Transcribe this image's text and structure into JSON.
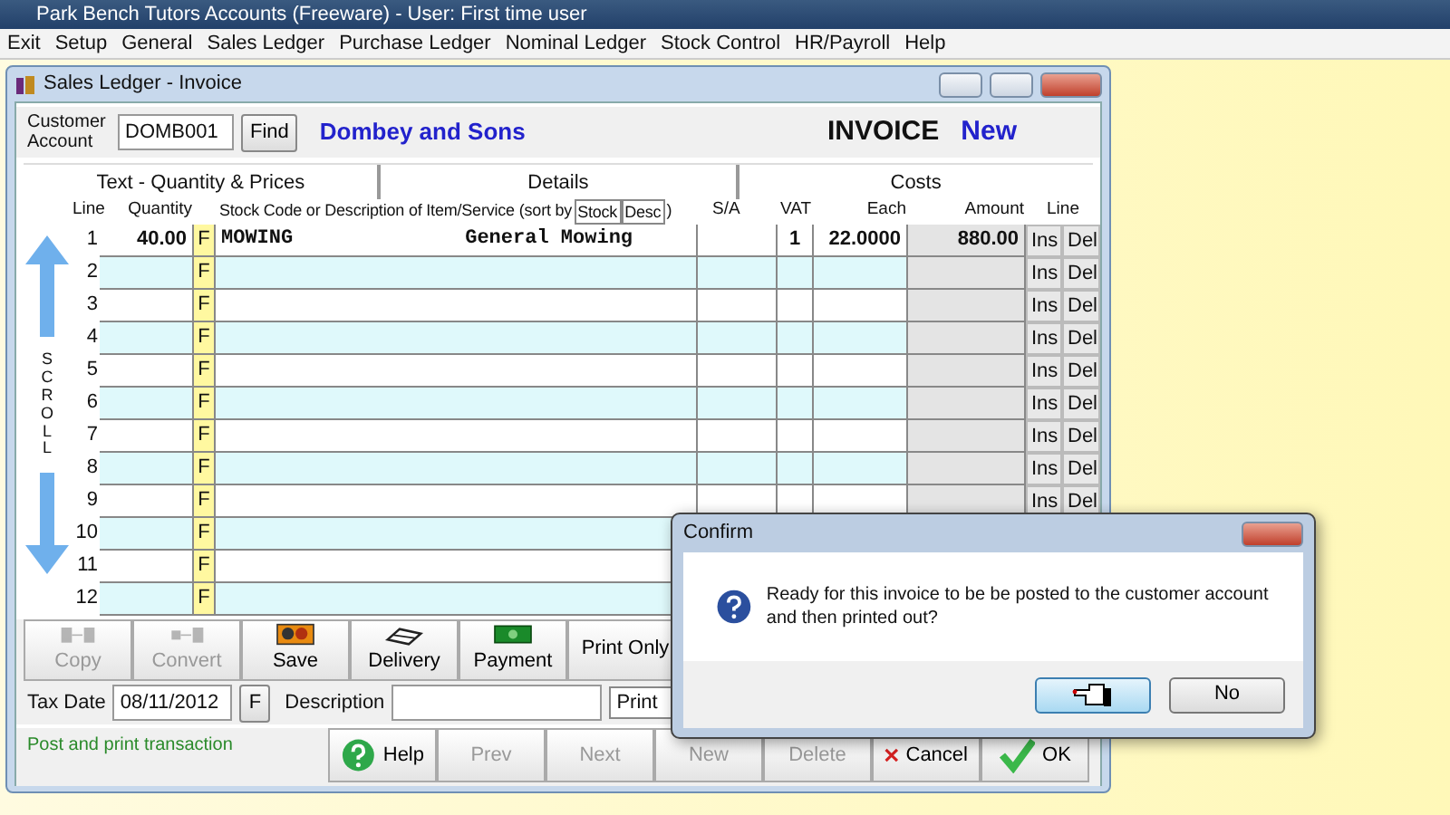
{
  "app": {
    "title": "Park Bench Tutors Accounts (Freeware)  -  User: First time user",
    "menu": [
      "Exit",
      "Setup",
      "General",
      "Sales Ledger",
      "Purchase Ledger",
      "Nominal Ledger",
      "Stock Control",
      "HR/Payroll",
      "Help"
    ]
  },
  "window": {
    "title": "Sales Ledger  -  Invoice",
    "customer_label": "Customer Account",
    "account": "DOMB001",
    "find": "Find",
    "customer_name": "Dombey and Sons",
    "doc_type": "INVOICE",
    "doc_status": "New"
  },
  "sections": [
    "Text - Quantity & Prices",
    "Details",
    "Costs"
  ],
  "columns": {
    "line": "Line",
    "quantity": "Quantity",
    "description": "Stock Code or Description of Item/Service (sort by",
    "sort_options": [
      "Stock",
      "Desc"
    ],
    "description_end": ")",
    "sa": "S/A",
    "vat": "VAT",
    "each": "Each",
    "amount": "Amount",
    "line_actions": "Line"
  },
  "scroll_label": "SCROLL",
  "rows": [
    {
      "line": "1",
      "quantity": "40.00",
      "flag": "F",
      "code": "MOWING",
      "description": "General Mowing",
      "vat": "1",
      "each": "22.0000",
      "amount": "880.00",
      "ins": "Ins",
      "del": "Del"
    },
    {
      "line": "2",
      "flag": "F",
      "ins": "Ins",
      "del": "Del"
    },
    {
      "line": "3",
      "flag": "F",
      "ins": "Ins",
      "del": "Del"
    },
    {
      "line": "4",
      "flag": "F",
      "ins": "Ins",
      "del": "Del"
    },
    {
      "line": "5",
      "flag": "F",
      "ins": "Ins",
      "del": "Del"
    },
    {
      "line": "6",
      "flag": "F",
      "ins": "Ins",
      "del": "Del"
    },
    {
      "line": "7",
      "flag": "F",
      "ins": "Ins",
      "del": "Del"
    },
    {
      "line": "8",
      "flag": "F",
      "ins": "Ins",
      "del": "Del"
    },
    {
      "line": "9",
      "flag": "F",
      "ins": "Ins",
      "del": "Del"
    },
    {
      "line": "10",
      "flag": "F"
    },
    {
      "line": "11",
      "flag": "F"
    },
    {
      "line": "12",
      "flag": "F"
    }
  ],
  "toolbar": [
    {
      "kind": "copy",
      "label": "Copy",
      "disabled": true
    },
    {
      "kind": "convert",
      "label": "Convert",
      "disabled": true
    },
    {
      "kind": "save",
      "label": "Save",
      "disabled": false
    },
    {
      "kind": "delivery",
      "label": "Delivery",
      "disabled": false
    },
    {
      "kind": "payment",
      "label": "Payment",
      "disabled": false
    },
    {
      "kind": "text",
      "label": "Print Only",
      "disabled": false
    }
  ],
  "form": {
    "tax_date_label": "Tax Date",
    "tax_date": "08/11/2012",
    "date_button": "F",
    "description_label": "Description",
    "print_mode": "Print"
  },
  "status": "Post and print transaction",
  "actions": [
    {
      "kind": "help",
      "label": "Help",
      "disabled": false
    },
    {
      "kind": "plain",
      "label": "Prev",
      "disabled": true
    },
    {
      "kind": "plain",
      "label": "Next",
      "disabled": true
    },
    {
      "kind": "plain",
      "label": "New",
      "disabled": true
    },
    {
      "kind": "plain",
      "label": "Delete",
      "disabled": true
    },
    {
      "kind": "cancel",
      "label": "Cancel",
      "disabled": false
    },
    {
      "kind": "ok",
      "label": "OK",
      "disabled": false
    }
  ],
  "dialog": {
    "title": "Confirm",
    "message": "Ready for this invoice to be be posted to the customer account and then printed out?",
    "buttons": [
      {
        "kind": "cursor",
        "selected": true
      },
      {
        "kind": "text",
        "label": "No",
        "selected": false
      }
    ]
  }
}
